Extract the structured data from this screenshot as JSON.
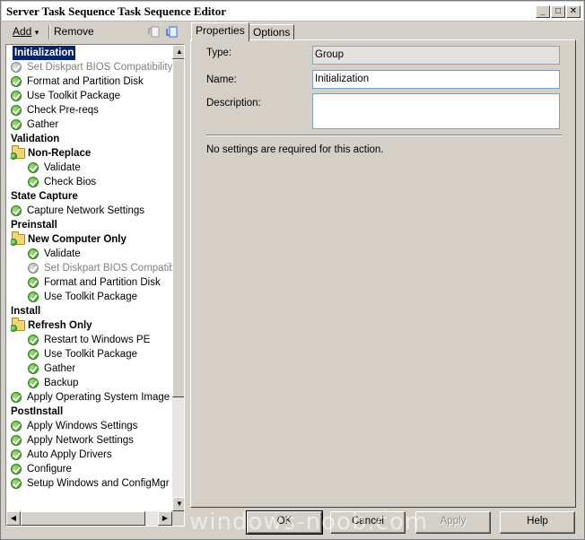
{
  "window": {
    "title": "Server Task Sequence Task Sequence Editor",
    "min_glyph": "_",
    "max_glyph": "□",
    "close_glyph": "✕"
  },
  "toolbar": {
    "add_label": "Add",
    "add_arrow": "▾",
    "remove_label": "Remove",
    "icons": [
      "move-up-icon",
      "move-down-icon"
    ]
  },
  "tree": {
    "items": [
      {
        "label": "Initialization",
        "kind": "group",
        "indent": 0,
        "icon": "none",
        "selected": true
      },
      {
        "label": "Set Diskpart BIOS Compatibility M",
        "kind": "step",
        "indent": 1,
        "icon": "check-gray",
        "disabled": true
      },
      {
        "label": "Format and Partition Disk",
        "kind": "step",
        "indent": 1,
        "icon": "check"
      },
      {
        "label": "Use Toolkit Package",
        "kind": "step",
        "indent": 1,
        "icon": "check"
      },
      {
        "label": "Check Pre-reqs",
        "kind": "step",
        "indent": 1,
        "icon": "check"
      },
      {
        "label": "Gather",
        "kind": "step",
        "indent": 1,
        "icon": "check"
      },
      {
        "label": "Validation",
        "kind": "group",
        "indent": 0,
        "icon": "none"
      },
      {
        "label": "Non-Replace",
        "kind": "group",
        "indent": 1,
        "icon": "folder"
      },
      {
        "label": "Validate",
        "kind": "step",
        "indent": 2,
        "icon": "check"
      },
      {
        "label": "Check Bios",
        "kind": "step",
        "indent": 2,
        "icon": "check"
      },
      {
        "label": "State Capture",
        "kind": "group",
        "indent": 0,
        "icon": "none"
      },
      {
        "label": "Capture Network Settings",
        "kind": "step",
        "indent": 1,
        "icon": "check"
      },
      {
        "label": "Preinstall",
        "kind": "group",
        "indent": 0,
        "icon": "none"
      },
      {
        "label": "New Computer Only",
        "kind": "group",
        "indent": 1,
        "icon": "folder"
      },
      {
        "label": "Validate",
        "kind": "step",
        "indent": 2,
        "icon": "check"
      },
      {
        "label": "Set Diskpart BIOS Compatibi",
        "kind": "step",
        "indent": 2,
        "icon": "check-gray",
        "disabled": true
      },
      {
        "label": "Format and Partition Disk",
        "kind": "step",
        "indent": 2,
        "icon": "check"
      },
      {
        "label": "Use Toolkit Package",
        "kind": "step",
        "indent": 2,
        "icon": "check"
      },
      {
        "label": "Install",
        "kind": "group",
        "indent": 0,
        "icon": "none"
      },
      {
        "label": "Refresh Only",
        "kind": "group",
        "indent": 1,
        "icon": "folder"
      },
      {
        "label": "Restart to Windows PE",
        "kind": "step",
        "indent": 2,
        "icon": "check"
      },
      {
        "label": "Use Toolkit Package",
        "kind": "step",
        "indent": 2,
        "icon": "check"
      },
      {
        "label": "Gather",
        "kind": "step",
        "indent": 2,
        "icon": "check"
      },
      {
        "label": "Backup",
        "kind": "step",
        "indent": 2,
        "icon": "check"
      },
      {
        "label": "Apply Operating System Image",
        "kind": "step",
        "indent": 1,
        "icon": "check"
      },
      {
        "label": "PostInstall",
        "kind": "group",
        "indent": 0,
        "icon": "none"
      },
      {
        "label": "Apply Windows Settings",
        "kind": "step",
        "indent": 1,
        "icon": "check"
      },
      {
        "label": "Apply Network Settings",
        "kind": "step",
        "indent": 1,
        "icon": "check"
      },
      {
        "label": "Auto Apply Drivers",
        "kind": "step",
        "indent": 1,
        "icon": "check"
      },
      {
        "label": "Configure",
        "kind": "step",
        "indent": 1,
        "icon": "check"
      },
      {
        "label": "Setup Windows and ConfigMgr",
        "kind": "step",
        "indent": 1,
        "icon": "check"
      }
    ]
  },
  "tabs": [
    {
      "label": "Properties",
      "active": true
    },
    {
      "label": "Options",
      "active": false
    }
  ],
  "properties": {
    "type_label": "Type:",
    "type_value": "Group",
    "name_label": "Name:",
    "name_value": "Initialization",
    "description_label": "Description:",
    "description_value": "",
    "message": "No settings are required  for this action."
  },
  "buttons": {
    "ok": "OK",
    "cancel": "Cancel",
    "apply": "Apply",
    "help": "Help"
  },
  "watermark": "windows-noob.com"
}
